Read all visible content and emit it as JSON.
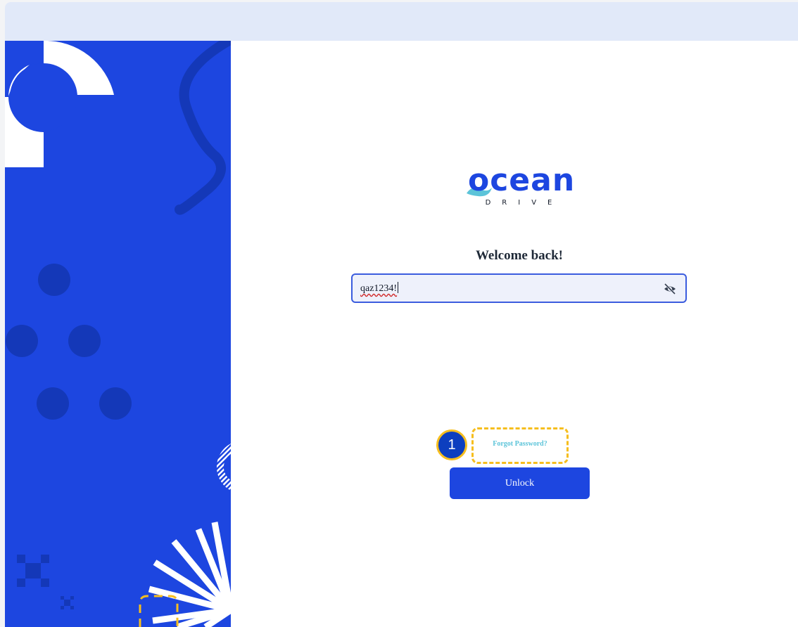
{
  "brand": {
    "name": "ocean",
    "subtitle": "DRIVE",
    "primary_color": "#1d46e0",
    "wave_color": "#5cc4d9"
  },
  "login": {
    "heading": "Welcome back!",
    "password_value": "qaz1234!",
    "password_visibility_icon": "eye-slash-icon",
    "forgot_password_label": "Forgot Password?",
    "unlock_label": "Unlock"
  },
  "annotation": {
    "step_number": "1",
    "highlight_color": "#f6be1e"
  }
}
